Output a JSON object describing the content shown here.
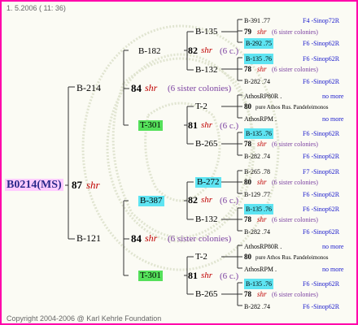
{
  "header": "1.  5.2006 ( 11: 36)",
  "footer": "Copyright 2004-2006 @ Karl Kehrle Foundation",
  "root": {
    "label": "B0214(MS)",
    "num": "87",
    "race": "shr"
  },
  "gen1": [
    {
      "label": "B-214",
      "num": "84",
      "race": "shr",
      "sis": "(6 sister colonies)"
    },
    {
      "label": "B-121",
      "num": "84",
      "race": "shr",
      "sis": "(6 sister colonies)"
    }
  ],
  "gen2": [
    {
      "label": "B-182",
      "num": "82",
      "race": "shr",
      "sis": "(6 c.)"
    },
    {
      "label": "T-301",
      "num": "81",
      "race": "shr",
      "sis": "(6 c.)"
    },
    {
      "label": "B-387",
      "num": "82",
      "race": "shr",
      "sis": "(6 c.)"
    },
    {
      "label": "T-301",
      "num": "81",
      "race": "shr",
      "sis": "(6 c.)"
    }
  ],
  "gen3": [
    {
      "label": "B-135"
    },
    {
      "label": "B-132"
    },
    {
      "label": "T-2"
    },
    {
      "label": "B-265"
    },
    {
      "label": "B-272"
    },
    {
      "label": "B-132"
    },
    {
      "label": "T-2"
    },
    {
      "label": "B-265"
    }
  ],
  "gen4": [
    {
      "label": "B-391 .77",
      "right": "F4 -Sinop72R"
    },
    {
      "num": "79",
      "race": "shr",
      "sis": "(6 sister colonies)"
    },
    {
      "label": "B-292 .75",
      "right": "F6 -Sinop62R"
    },
    {
      "label": "B-135 .76",
      "right": "F6 -Sinop62R"
    },
    {
      "num": "78",
      "race": "shr",
      "sis": "(6 sister colonies)"
    },
    {
      "label": "B-282 .74",
      "right": "F6 -Sinop62R"
    },
    {
      "label": "AthosRP80R .",
      "right": "no more"
    },
    {
      "num": "80",
      "text": "pure Athos Rus. Pandeleimonos"
    },
    {
      "label": "AthosRPM .",
      "right": "no more"
    },
    {
      "label": "B-135 .76",
      "right": "F6 -Sinop62R"
    },
    {
      "num": "78",
      "race": "shr",
      "sis": "(6 sister colonies)"
    },
    {
      "label": "B-282 .74",
      "right": "F6 -Sinop62R"
    },
    {
      "label": "B-265 .78",
      "right": "F7 -Sinop62R"
    },
    {
      "num": "80",
      "race": "shr",
      "sis": "(6 sister colonies)"
    },
    {
      "label": "B-129 .77",
      "right": "F6 -Sinop62R"
    },
    {
      "label": "B-135 .76",
      "right": "F6 -Sinop62R"
    },
    {
      "num": "78",
      "race": "shr",
      "sis": "(6 sister colonies)"
    },
    {
      "label": "B-282 .74",
      "right": "F6 -Sinop62R"
    },
    {
      "label": "AthosRP80R .",
      "right": "no more"
    },
    {
      "num": "80",
      "text": "pure Athos Rus. Pandeleimonos"
    },
    {
      "label": "AthosRPM .",
      "right": "no more"
    },
    {
      "label": "B-135 .76",
      "right": "F6 -Sinop62R"
    },
    {
      "num": "78",
      "race": "shr",
      "sis": "(6 sister colonies)"
    },
    {
      "label": "B-282 .74",
      "right": "F6 -Sinop62R"
    }
  ],
  "colors": {
    "border": "#ff00aa",
    "cyan": "#5ee4f2",
    "green": "#55e05a",
    "shr": "#c00000",
    "blue": "#1a1acc"
  }
}
